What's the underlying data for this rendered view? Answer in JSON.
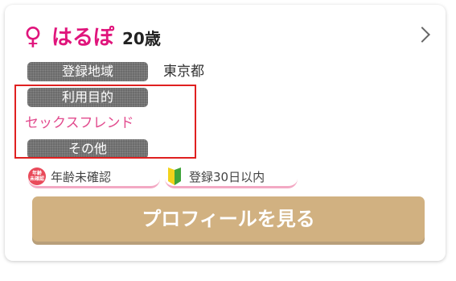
{
  "profile": {
    "gender_symbol": "♀",
    "name": "はるぽ",
    "age": "20歳"
  },
  "fields": {
    "area_label": "登録地域",
    "area_value": "東京都",
    "purpose_label": "利用目的",
    "purpose_value": "セックスフレンド",
    "other_label": "その他"
  },
  "badges": {
    "age_icon_text": [
      "年齢",
      "未確認"
    ],
    "age_label": "年齢未確認",
    "registration_label": "登録30日以内"
  },
  "cta": {
    "label": "プロフィールを見る"
  },
  "colors": {
    "accent_pink": "#e0157c",
    "purpose_pink": "#e24b8e",
    "tag_gray": "#6b6b6b",
    "cta_tan": "#d1b181",
    "highlight_red": "#e02020"
  },
  "icons": {
    "chevron": "chevron-right-icon",
    "age": "age-unverified-icon",
    "registration": "beginner-leaf-icon"
  }
}
